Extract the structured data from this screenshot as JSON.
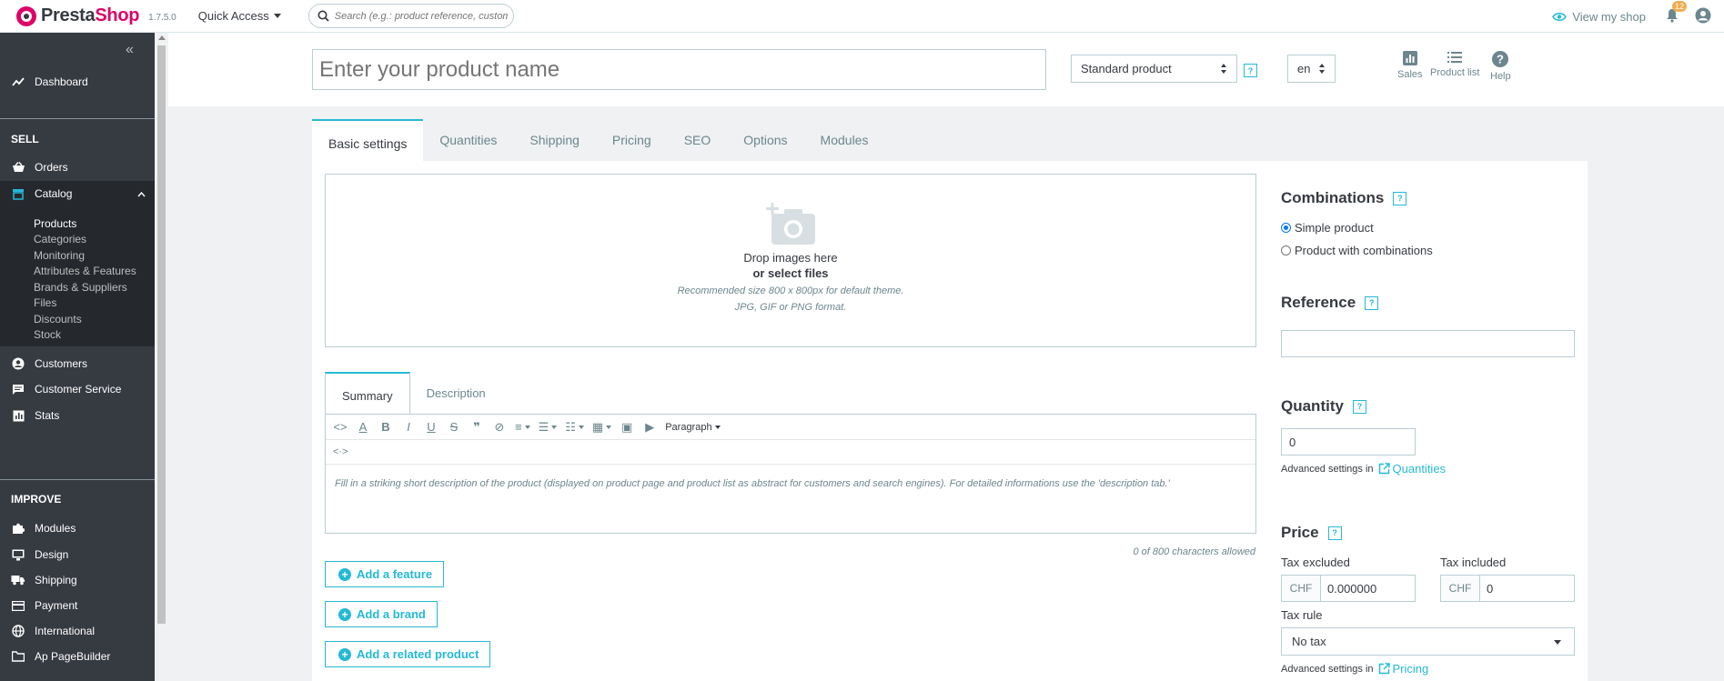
{
  "header": {
    "logo_text_a": "Presta",
    "logo_text_b": "Shop",
    "version": "1.7.5.0",
    "quick_access": "Quick Access",
    "search_placeholder": "Search (e.g.: product reference, customer name...)",
    "view_shop": "View my shop",
    "notifications_count": "12"
  },
  "sidebar": {
    "dashboard": "Dashboard",
    "sell_section": "SELL",
    "orders": "Orders",
    "catalog": "Catalog",
    "catalog_sub": [
      "Products",
      "Categories",
      "Monitoring",
      "Attributes & Features",
      "Brands & Suppliers",
      "Files",
      "Discounts",
      "Stock"
    ],
    "customers": "Customers",
    "customer_service": "Customer Service",
    "stats": "Stats",
    "improve_section": "IMPROVE",
    "modules": "Modules",
    "design": "Design",
    "shipping": "Shipping",
    "payment": "Payment",
    "international": "International",
    "ap_pagebuilder": "Ap PageBuilder"
  },
  "product_header": {
    "name_placeholder": "Enter your product name",
    "type": "Standard product",
    "lang": "en",
    "tools": [
      "Sales",
      "Product list",
      "Help"
    ],
    "help_glyph": "?"
  },
  "tabs": [
    "Basic settings",
    "Quantities",
    "Shipping",
    "Pricing",
    "SEO",
    "Options",
    "Modules"
  ],
  "dropzone": {
    "line1": "Drop images here",
    "line2": "or select files",
    "line3": "Recommended size 800 x 800px for default theme.",
    "line4": "JPG, GIF or PNG format."
  },
  "editor": {
    "tabs": [
      "Summary",
      "Description"
    ],
    "format_label": "Paragraph",
    "placeholder": "Fill in a striking short description of the product (displayed on product page and product list as abstract for customers and search engines). For detailed informations use the 'description tab.'",
    "char_count": "0 of 800 characters allowed"
  },
  "buttons": {
    "add_feature": "Add a feature",
    "add_brand": "Add a brand",
    "add_related": "Add a related product"
  },
  "right": {
    "combinations_title": "Combinations",
    "simple_product": "Simple product",
    "with_combinations": "Product with combinations",
    "reference_title": "Reference",
    "reference_value": "",
    "quantity_title": "Quantity",
    "quantity_value": "0",
    "advanced_in": "Advanced settings in",
    "quantities_link": "Quantities",
    "price_title": "Price",
    "tax_excluded": "Tax excluded",
    "tax_included": "Tax included",
    "currency": "CHF",
    "price_excl_value": "0.000000",
    "price_incl_value": "0",
    "tax_rule": "Tax rule",
    "tax_rule_value": "No tax",
    "pricing_link": "Pricing"
  },
  "colors": {
    "accent": "#25b9d7",
    "brand": "#df0067",
    "sidebar_bg": "#363a41"
  }
}
